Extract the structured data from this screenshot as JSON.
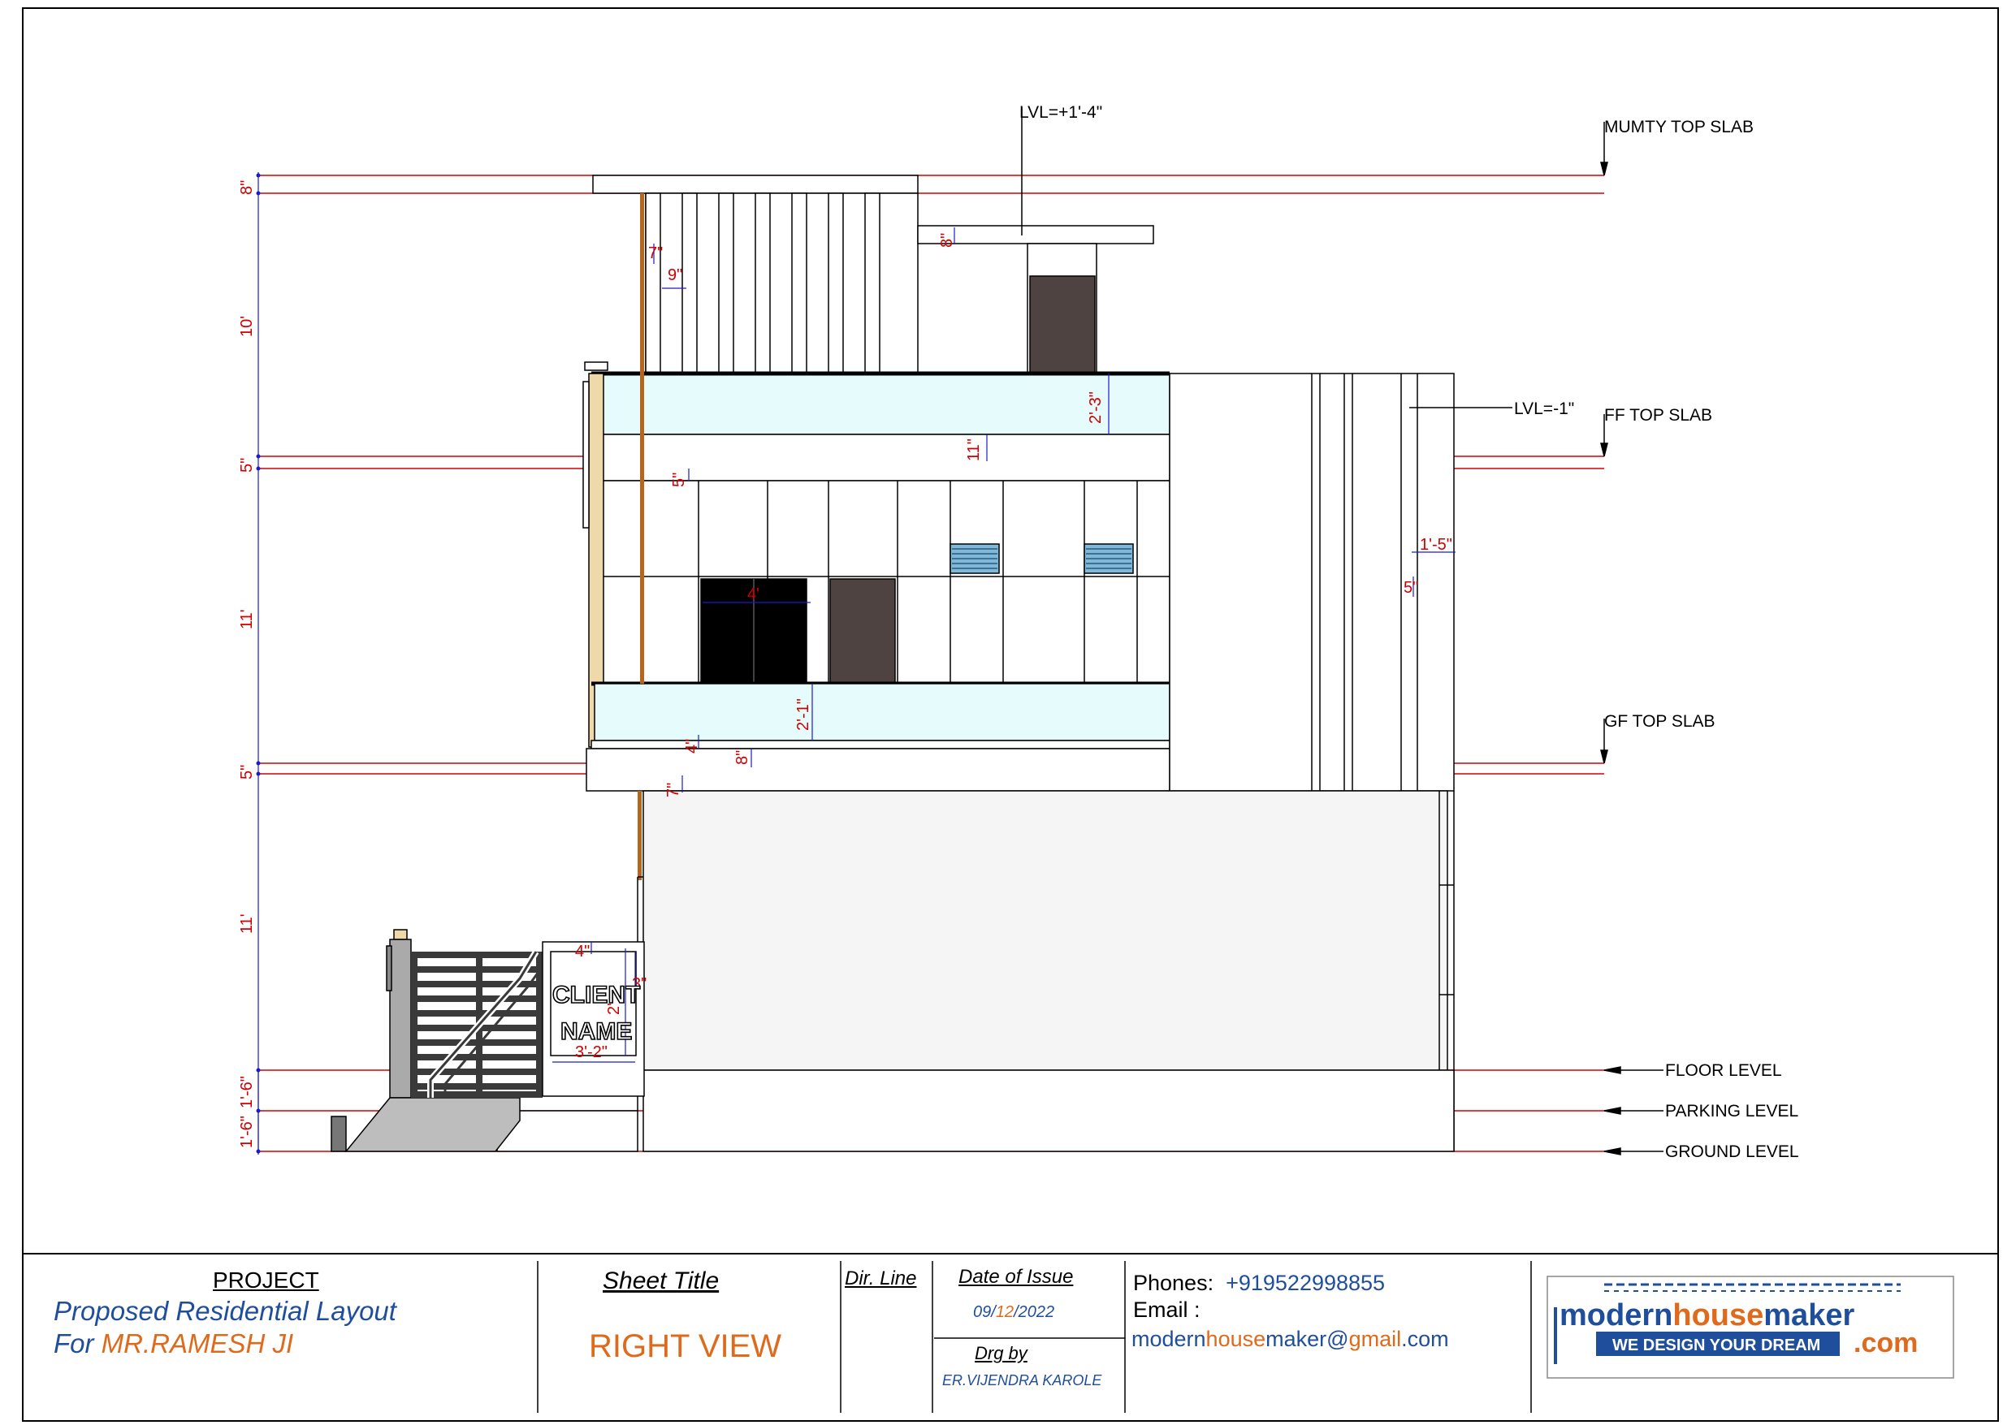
{
  "levels": {
    "mumty_top_slab": "MUMTY TOP SLAB",
    "ff_top_slab": "FF TOP SLAB",
    "gf_top_slab": "GF TOP SLAB",
    "floor_level": "FLOOR LEVEL",
    "parking_level": "PARKING LEVEL",
    "ground_level": "GROUND LEVEL",
    "lvl_top": "LVL=+1'-4\"",
    "lvl_mid": "LVL=-1\""
  },
  "vertical_dims": {
    "d1": "8\"",
    "d2": "10'",
    "d3": "5\"",
    "d4": "11'",
    "d5": "5\"",
    "d6": "11'",
    "d7": "1'-6\"",
    "d8": "1'-6\""
  },
  "inner_dims": {
    "d7in": "7\"",
    "d9in": "9\"",
    "d8in_mumty": "8\"",
    "d2_3": "2'-3\"",
    "d11in": "11\"",
    "d5in_ff": "5\"",
    "d1_5": "1'-5\"",
    "d5in_side": "5\"",
    "d4ft": "4'",
    "d2_1": "2'-1\"",
    "d4in": "4\"",
    "d8in_gf": "8\"",
    "d7in_gf": "7\"",
    "d4in_gate": "4\"",
    "d3in_gate": "3\"",
    "d2ft_gate": "2'",
    "d3_2": "3'-2\""
  },
  "client_board": {
    "line1": "CLIENT",
    "line2": "NAME"
  },
  "title_block": {
    "project_heading": "PROJECT",
    "project_line1": "Proposed Residential Layout",
    "project_for": "For ",
    "project_client": "MR.RAMESH JI",
    "sheet_title_heading": "Sheet Title",
    "sheet_title": "RIGHT VIEW",
    "dir_line": "Dir. Line",
    "date_heading": "Date of Issue",
    "date_day": "09/",
    "date_month": "12",
    "date_year": "/2022",
    "drg_by_heading": "Drg by",
    "drg_by": "ER.VIJENDRA KAROLE",
    "phones_label": "Phones:",
    "phones_value": "+919522998855",
    "email_label": "Email :",
    "email_part1": "modern",
    "email_part2": "house",
    "email_part3": "maker@",
    "email_part4": "gmail",
    "email_part5": ".com"
  },
  "logo": {
    "word1": "modern",
    "word2": "house",
    "word3": "maker",
    "tagline": "WE DESIGN YOUR DREAM",
    "tld": ".com"
  },
  "colors": {
    "dim_red": "#d00000",
    "dim_blue": "#1a1ad0",
    "title_blue": "#1f4e9c",
    "accent_orange": "#e06a1b",
    "glass": "#e6fbfb",
    "door": "#4e4341",
    "pillar": "#efd9aa"
  }
}
